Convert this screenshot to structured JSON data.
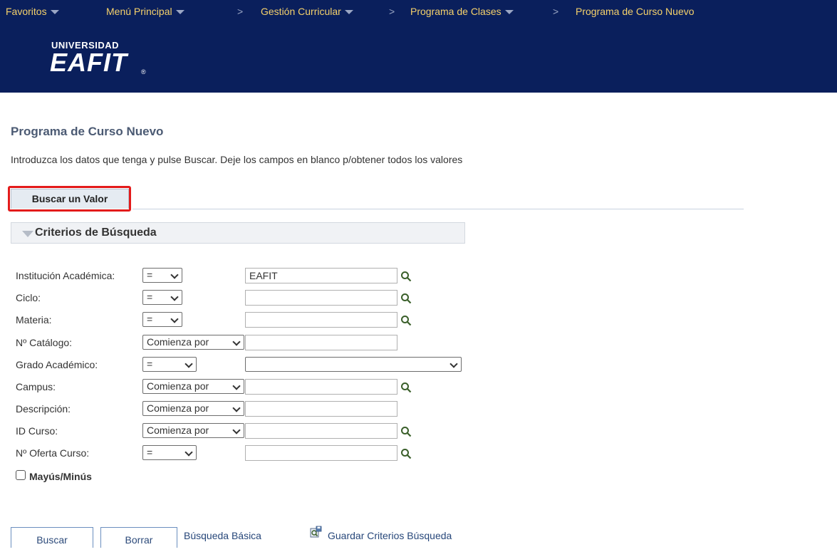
{
  "nav": {
    "favoritos": "Favoritos",
    "menu_principal": "Menú Principal",
    "gestion_curricular": "Gestión Curricular",
    "programa_clases": "Programa de Clases",
    "current": "Programa de Curso Nuevo",
    "separator": ">"
  },
  "logo": {
    "top": "UNIVERSIDAD",
    "main": "EAFIT",
    "reg": "®"
  },
  "page": {
    "title": "Programa de Curso Nuevo",
    "instructions": "Introduzca los datos que tenga y pulse Buscar. Deje los campos en blanco p/obtener todos los valores"
  },
  "tab": {
    "label": "Buscar un Valor"
  },
  "section": {
    "label": "Criterios de Búsqueda"
  },
  "fields": [
    {
      "label": "Institución Académica:",
      "operator": "=",
      "value": "EAFIT"
    },
    {
      "label": "Ciclo:",
      "operator": "=",
      "value": ""
    },
    {
      "label": "Materia:",
      "operator": "=",
      "value": ""
    },
    {
      "label": "Nº Catálogo:",
      "operator": "Comienza por",
      "value": ""
    },
    {
      "label": "Grado Académico:",
      "operator": "=",
      "value": ""
    },
    {
      "label": "Campus:",
      "operator": "Comienza por",
      "value": ""
    },
    {
      "label": "Descripción:",
      "operator": "Comienza por",
      "value": ""
    },
    {
      "label": "ID Curso:",
      "operator": "Comienza por",
      "value": ""
    },
    {
      "label": "Nº Oferta Curso:",
      "operator": "=",
      "value": ""
    }
  ],
  "case_sensitive": {
    "label": "Mayús/Minús",
    "checked": false
  },
  "actions": {
    "buscar": "Buscar",
    "borrar": "Borrar",
    "busqueda_basica": "Búsqueda Básica",
    "guardar_criterios": "Guardar Criterios Búsqueda"
  },
  "colors": {
    "nav_bg": "#0a1f5c",
    "nav_text": "#f5d16b",
    "highlight": "#e31b1b",
    "link": "#27477a"
  }
}
